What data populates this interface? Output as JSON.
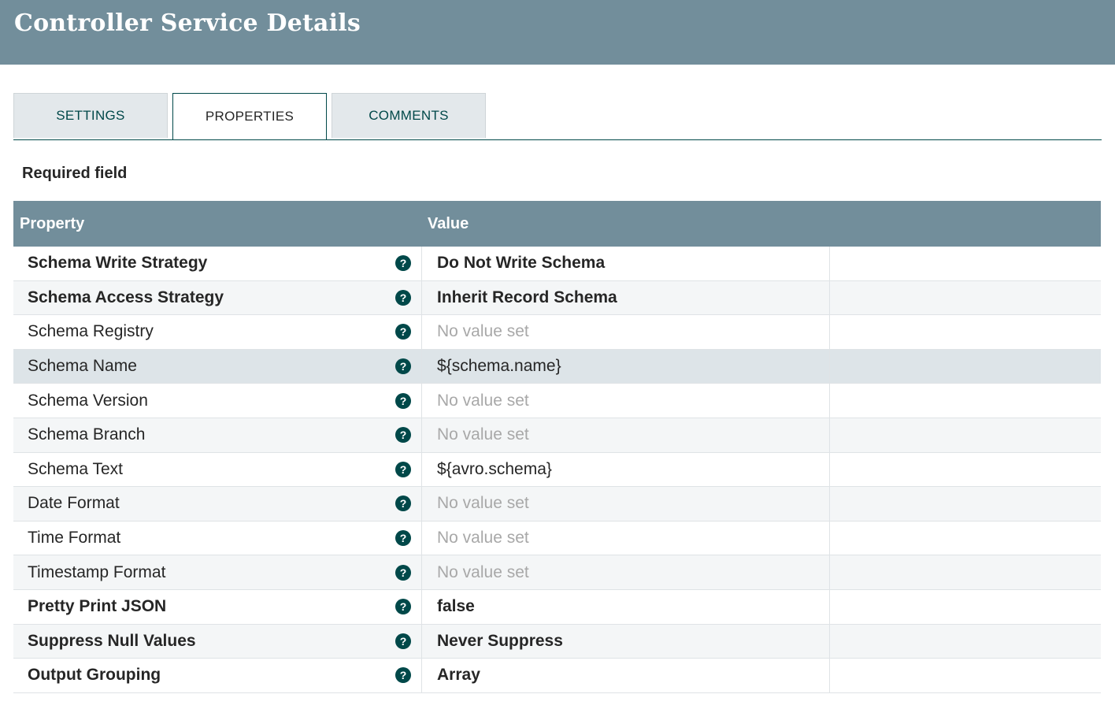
{
  "header": {
    "title": "Controller Service Details"
  },
  "tabs": [
    {
      "label": "SETTINGS",
      "active": false
    },
    {
      "label": "PROPERTIES",
      "active": true
    },
    {
      "label": "COMMENTS",
      "active": false
    }
  ],
  "required_label": "Required field",
  "table": {
    "headers": {
      "property": "Property",
      "value": "Value"
    },
    "rows": [
      {
        "name": "Schema Write Strategy",
        "value": "Do Not Write Schema",
        "required": true,
        "unset": false
      },
      {
        "name": "Schema Access Strategy",
        "value": "Inherit Record Schema",
        "required": true,
        "unset": false
      },
      {
        "name": "Schema Registry",
        "value": "No value set",
        "required": false,
        "unset": true
      },
      {
        "name": "Schema Name",
        "value": "${schema.name}",
        "required": false,
        "unset": false,
        "selected": true
      },
      {
        "name": "Schema Version",
        "value": "No value set",
        "required": false,
        "unset": true
      },
      {
        "name": "Schema Branch",
        "value": "No value set",
        "required": false,
        "unset": true
      },
      {
        "name": "Schema Text",
        "value": "${avro.schema}",
        "required": false,
        "unset": false
      },
      {
        "name": "Date Format",
        "value": "No value set",
        "required": false,
        "unset": true
      },
      {
        "name": "Time Format",
        "value": "No value set",
        "required": false,
        "unset": true
      },
      {
        "name": "Timestamp Format",
        "value": "No value set",
        "required": false,
        "unset": true
      },
      {
        "name": "Pretty Print JSON",
        "value": "false",
        "required": true,
        "unset": false
      },
      {
        "name": "Suppress Null Values",
        "value": "Never Suppress",
        "required": true,
        "unset": false
      },
      {
        "name": "Output Grouping",
        "value": "Array",
        "required": true,
        "unset": false
      }
    ]
  },
  "icons": {
    "help": "question-circle-icon",
    "help_glyph": "?"
  },
  "colors": {
    "header_bg": "#728e9b",
    "accent": "#004849",
    "unset_text": "#a8a8a8"
  }
}
